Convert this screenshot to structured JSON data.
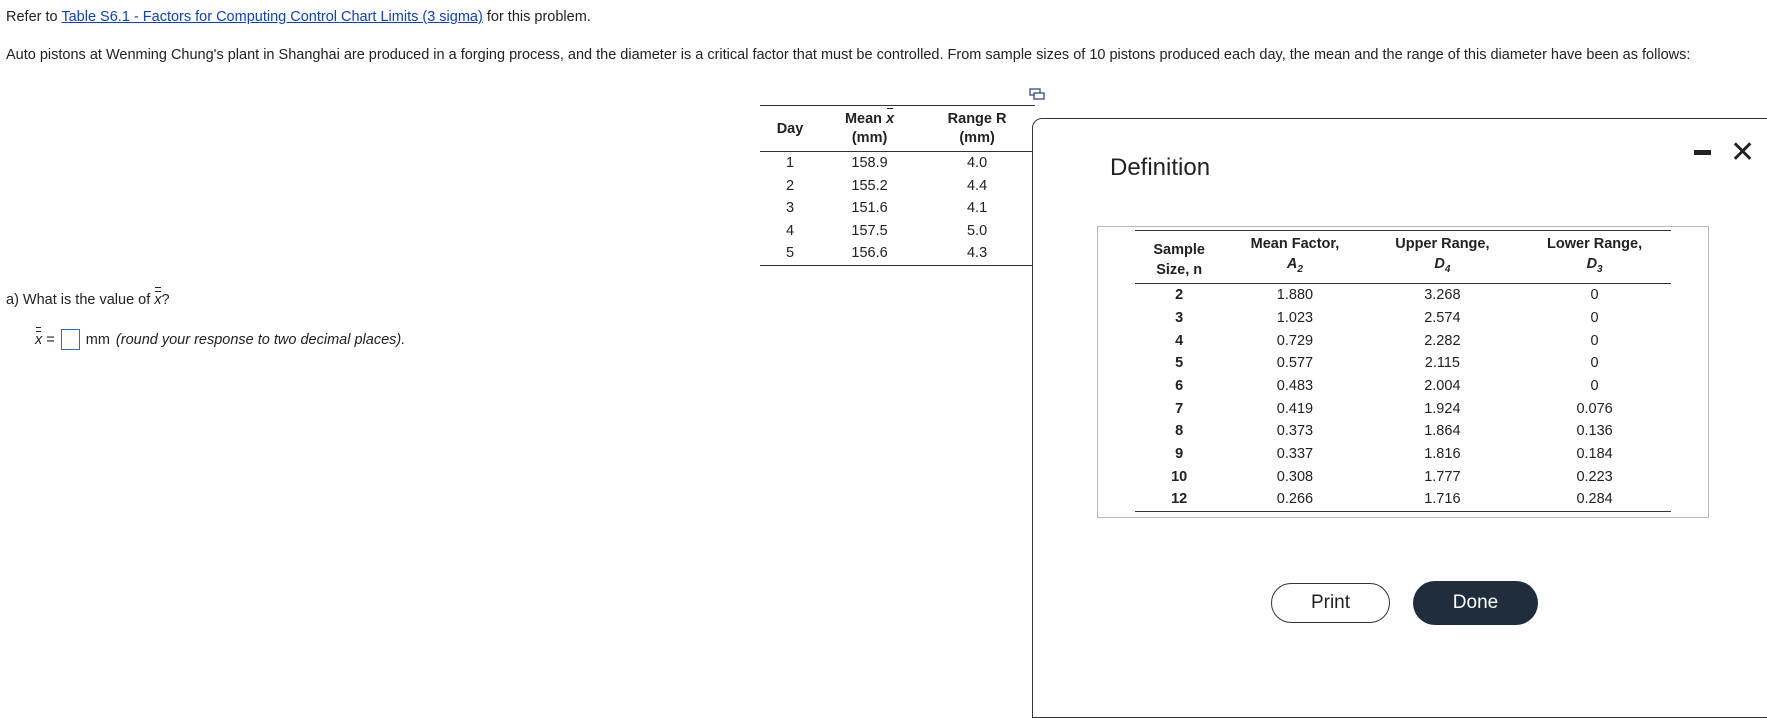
{
  "intro": {
    "prefix": "Refer to ",
    "link_text": "Table S6.1 - Factors for Computing Control Chart Limits (3 sigma)",
    "suffix": " for this problem."
  },
  "problem_text": "Auto pistons at Wenming Chung's plant in Shanghai are produced in a forging process, and the diameter is a critical factor that must be controlled. From sample sizes of 10 pistons produced each day, the mean and the range of this diameter have been as follows:",
  "data_table": {
    "headers": {
      "day": "Day",
      "mean_label": "Mean",
      "mean_symbol": "x",
      "mean_unit": "(mm)",
      "range_label": "Range R",
      "range_unit": "(mm)"
    },
    "rows": [
      {
        "day": "1",
        "mean": "158.9",
        "range": "4.0"
      },
      {
        "day": "2",
        "mean": "155.2",
        "range": "4.4"
      },
      {
        "day": "3",
        "mean": "151.6",
        "range": "4.1"
      },
      {
        "day": "4",
        "mean": "157.5",
        "range": "5.0"
      },
      {
        "day": "5",
        "mean": "156.6",
        "range": "4.3"
      }
    ]
  },
  "question": {
    "prefix": "a) What is the value of ",
    "symbol": "x",
    "suffix": "?"
  },
  "answer": {
    "symbol": "x",
    "equals": "=",
    "value": "",
    "unit": "mm",
    "hint": "(round your response to two decimal places)."
  },
  "modal": {
    "title": "Definition",
    "print_label": "Print",
    "done_label": "Done",
    "close_glyph": "✕",
    "def_table": {
      "headers": {
        "n_line1": "Sample",
        "n_line2": "Size, n",
        "a2_line1": "Mean Factor,",
        "a2_sym": "A",
        "a2_sub": "2",
        "d4_line1": "Upper Range,",
        "d4_sym": "D",
        "d4_sub": "4",
        "d3_line1": "Lower Range,",
        "d3_sym": "D",
        "d3_sub": "3"
      },
      "rows": [
        {
          "n": "2",
          "a2": "1.880",
          "d4": "3.268",
          "d3": "0"
        },
        {
          "n": "3",
          "a2": "1.023",
          "d4": "2.574",
          "d3": "0"
        },
        {
          "n": "4",
          "a2": "0.729",
          "d4": "2.282",
          "d3": "0"
        },
        {
          "n": "5",
          "a2": "0.577",
          "d4": "2.115",
          "d3": "0"
        },
        {
          "n": "6",
          "a2": "0.483",
          "d4": "2.004",
          "d3": "0"
        },
        {
          "n": "7",
          "a2": "0.419",
          "d4": "1.924",
          "d3": "0.076"
        },
        {
          "n": "8",
          "a2": "0.373",
          "d4": "1.864",
          "d3": "0.136"
        },
        {
          "n": "9",
          "a2": "0.337",
          "d4": "1.816",
          "d3": "0.184"
        },
        {
          "n": "10",
          "a2": "0.308",
          "d4": "1.777",
          "d3": "0.223"
        },
        {
          "n": "12",
          "a2": "0.266",
          "d4": "1.716",
          "d3": "0.284"
        }
      ]
    }
  },
  "colors": {
    "link": "#0b3fd6",
    "done_bg": "#1f2d3d",
    "answer_border": "#1e6fe0"
  },
  "icons": {
    "copy": "copy-table-icon",
    "minimize": "minimize-icon",
    "close": "close-icon"
  }
}
